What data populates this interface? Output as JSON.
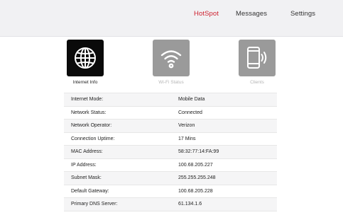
{
  "nav": {
    "items": [
      {
        "label": "HotSpot",
        "active": true
      },
      {
        "label": "Messages",
        "active": false
      },
      {
        "label": "Settings",
        "active": false
      }
    ]
  },
  "tiles": [
    {
      "label": "Internet Info",
      "icon": "globe-icon",
      "active": true
    },
    {
      "label": "Wi-Fi Status",
      "icon": "wifi-icon",
      "active": false
    },
    {
      "label": "Clients",
      "icon": "phone-signal-icon",
      "active": false
    }
  ],
  "info": {
    "rows": [
      {
        "key": "Internet Mode:",
        "value": "Mobile Data"
      },
      {
        "key": "Network Status:",
        "value": "Connected"
      },
      {
        "key": "Network Operator:",
        "value": "Verizon"
      },
      {
        "key": "Connection Uptime:",
        "value": "17 Mins"
      },
      {
        "key": "MAC Address:",
        "value": "58:32:77:14:FA:99"
      },
      {
        "key": "IP Address:",
        "value": "100.68.205.227"
      },
      {
        "key": "Subnet Mask:",
        "value": "255.255.255.248"
      },
      {
        "key": "Default Gateway:",
        "value": "100.68.205.228"
      },
      {
        "key": "Primary DNS Server:",
        "value": "61.134.1.6"
      }
    ]
  },
  "colors": {
    "accent": "#cd1e2c",
    "active_tile": "#0a0a0a",
    "inactive_tile": "#9a9a9a",
    "topbar": "#f1f1f3"
  }
}
